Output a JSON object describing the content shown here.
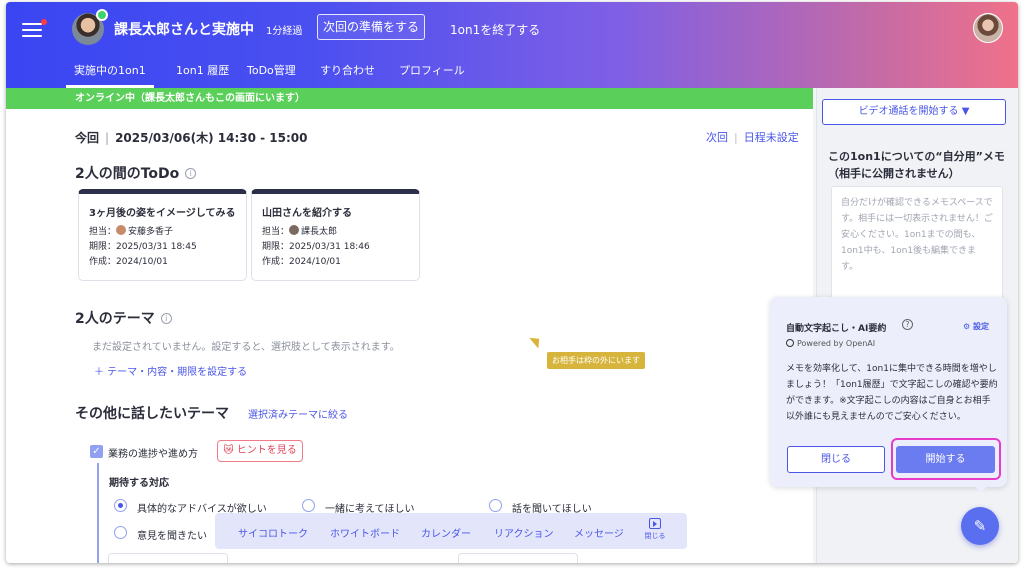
{
  "header": {
    "title": "課長太郎さんと実施中",
    "elapsed": "1分経過",
    "prepare_button": "次回の準備をする",
    "end_link": "1on1を終了する",
    "tabs": [
      {
        "label": "実施中の1on1",
        "active": true
      },
      {
        "label": "1on1 履歴",
        "active": false
      },
      {
        "label": "ToDo管理",
        "active": false
      },
      {
        "label": "すり合わせ",
        "active": false
      },
      {
        "label": "プロフィール",
        "active": false
      }
    ]
  },
  "status_bar": "オンライン中（課長太郎さんもこの画面にいます）",
  "meeting": {
    "now_label": "今回",
    "datetime": "2025/03/06(木) 14:30 - 15:00",
    "next_label": "次回",
    "next_value": "日程未設定"
  },
  "todo": {
    "title": "2人の間のToDo",
    "info_icon": "i",
    "cards": [
      {
        "title": "3ヶ月後の姿をイメージしてみる",
        "assignee_label": "担当：",
        "assignee": "安藤多香子",
        "due": "期限：2025/03/31 18:45",
        "created": "作成：2024/10/01"
      },
      {
        "title": "山田さんを紹介する",
        "assignee_label": "担当：",
        "assignee": "課長太郎",
        "due": "期限：2025/03/31 18:46",
        "created": "作成：2024/10/01"
      }
    ]
  },
  "theme": {
    "title": "2人のテーマ",
    "info_icon": "i",
    "empty_note": "まだ設定されていません。設定すると、選択肢として表示されます。",
    "set_link": "＋  テーマ・内容・期限を設定する"
  },
  "partner_tip": "お相手は枠の外にいます",
  "other": {
    "title": "その他に話したいテーマ",
    "filter_link": "選択済みテーマに絞る",
    "item_label": "業務の進捗や進め方",
    "checkmark": "✓",
    "hint_button": "😿 ヒントを見る",
    "expected_title": "期待する対応",
    "options": [
      {
        "label": "具体的なアドバイスが欲しい",
        "selected": true
      },
      {
        "label": "一緒に考えてほしい",
        "selected": false
      },
      {
        "label": "話を聞いてほしい",
        "selected": false
      },
      {
        "label": "意見を聞きたい",
        "selected": false
      }
    ]
  },
  "toolbar": {
    "items": [
      "サイコロトーク",
      "ホワイトボード",
      "カレンダー",
      "リアクション",
      "メッセージ"
    ],
    "close_label": "閉じる"
  },
  "sidebar": {
    "video_button": "ビデオ通話を開始する ▼",
    "memo_title": "この1on1についての“自分用”メモ（相手に公開されません）",
    "memo_placeholder": "自分だけが確認できるメモスペースです。相手には一切表示されません！ご安心ください。1on1までの間も、1on1中も、1on1後も編集できます。"
  },
  "ai_popup": {
    "title": "自動文字起こし・AI要約",
    "help_icon": "?",
    "settings_label": "⚙ 設定",
    "powered_by": "Powered by OpenAI",
    "body": "メモを効率化して、1on1に集中できる時間を増やしましょう！「1on1履歴」で文字起こしの確認や要約ができます。※文字起こしの内容はご自身とお相手以外誰にも見えませんのでご安心ください。",
    "close_button": "閉じる",
    "start_button": "開始する",
    "highlight_color": "#e63cc8"
  },
  "fab_icon": "✎",
  "colors": {
    "accent": "#4a56e8",
    "online": "#5ad05a"
  }
}
